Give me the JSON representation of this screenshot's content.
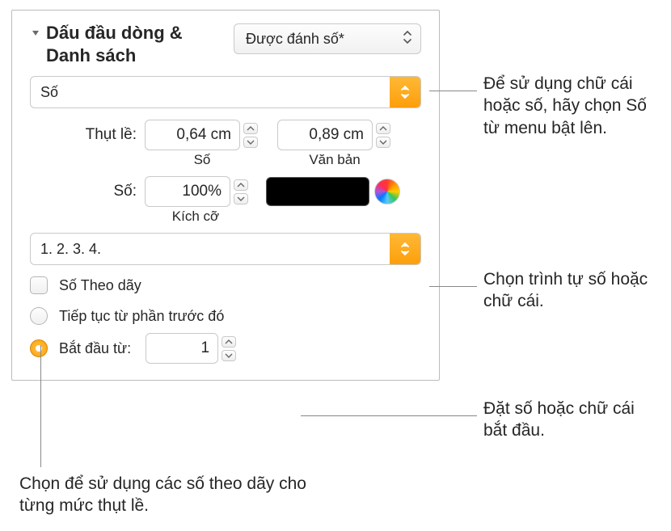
{
  "section_title": "Dấu đầu dòng & Danh sách",
  "style_select": "Được đánh số*",
  "type_select": "Số",
  "indent": {
    "label": "Thụt lề:",
    "number_value": "0,64 cm",
    "number_sublabel": "Số",
    "text_value": "0,89 cm",
    "text_sublabel": "Văn bản"
  },
  "size": {
    "label": "Số:",
    "value": "100%",
    "sublabel": "Kích cỡ"
  },
  "sequence_select": "1. 2. 3. 4.",
  "checkbox_label": "Số Theo dãy",
  "radio1_label": "Tiếp tục từ phần trước đó",
  "radio2_label": "Bắt đầu từ:",
  "start_value": "1",
  "callouts": {
    "c1": "Để sử dụng chữ cái hoặc số, hãy chọn Số từ menu bật lên.",
    "c2": "Chọn trình tự số hoặc chữ cái.",
    "c3": "Đặt số hoặc chữ cái bắt đầu.",
    "c4": "Chọn để sử dụng các số theo dãy cho từng mức thụt lề."
  }
}
